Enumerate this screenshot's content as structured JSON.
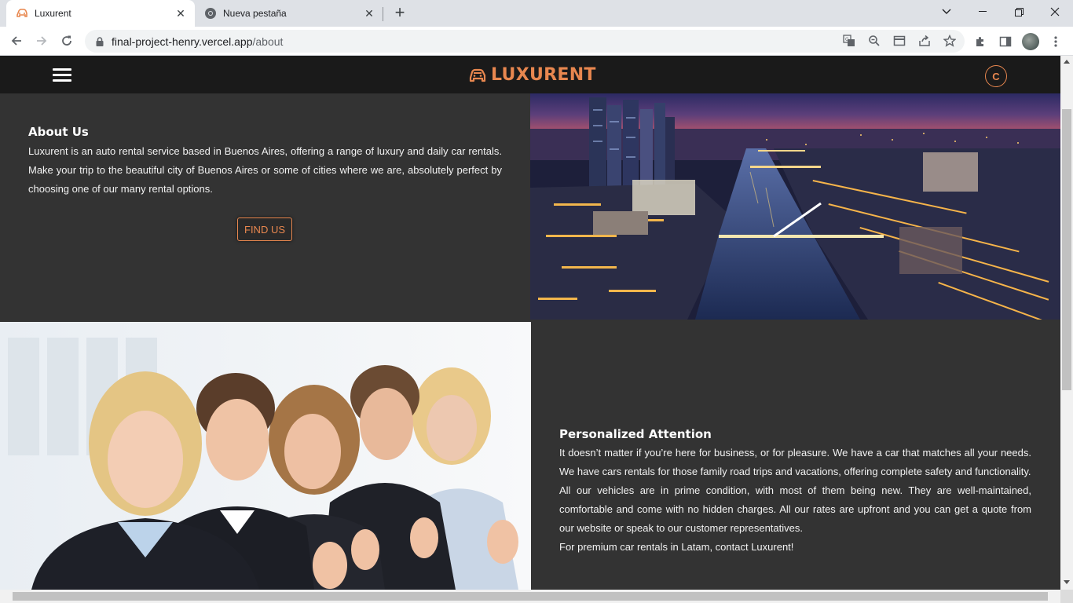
{
  "browser": {
    "tabs": [
      {
        "title": "Luxurent",
        "active": true
      },
      {
        "title": "Nueva pestaña",
        "active": false
      }
    ],
    "url_host": "final-project-henry.vercel.app",
    "url_path": "/about"
  },
  "site": {
    "brand": "LUXURENT",
    "user_initial": "C",
    "accent_color": "#e8874f",
    "nav_color": "#1a1a1a",
    "section_color": "#333333"
  },
  "about": {
    "heading": "About Us",
    "text": "Luxurent is an auto rental service based in Buenos Aires, offering a range of luxury and daily car rentals. Make your trip to the beautiful city of Buenos Aires or some of cities where we are, absolutely perfect by choosing one of our many rental options.",
    "button_label": "FIND US"
  },
  "attention": {
    "heading": "Personalized Attention",
    "paragraphs": [
      "It doesn’t matter if you’re here for business, or for pleasure. We have a car that matches all your needs. We have cars rentals for those family road trips and vacations, offering complete safety and functionality.",
      "All our vehicles are in prime condition, with most of them being new. They are well-maintained, comfortable and come with no hidden charges. All our rates are upfront and you can get a quote from our website or speak to our customer representatives.",
      "For premium car rentals in Latam, contact Luxurent!"
    ]
  },
  "icons": {
    "tab_favicon": "car-logo-icon",
    "tab2_favicon": "chrome-icon",
    "lock": "lock-icon"
  }
}
